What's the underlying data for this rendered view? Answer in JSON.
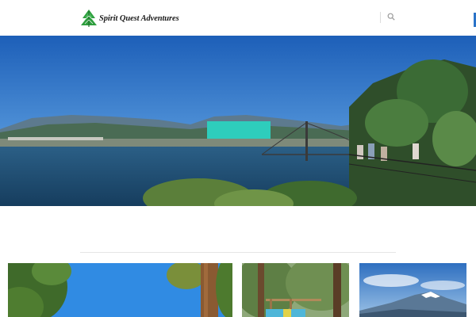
{
  "header": {
    "logo_text": "Spirit Quest Adventures",
    "logo_icon": "pine-tree-icon",
    "search_icon": "search-icon"
  },
  "hero": {
    "cta_label": "",
    "image": "scenic-bay-bridge-panorama"
  },
  "cards": [
    {
      "image": "forest-trees-blue-sky"
    },
    {
      "image": "forest-trail-wooden-railing"
    },
    {
      "image": "snowy-mountain-peak"
    }
  ],
  "colors": {
    "accent": "#2ecdbc",
    "logo_green": "#2e9e3e",
    "edge_accent": "#2a73c8",
    "background": "#ffffff"
  }
}
